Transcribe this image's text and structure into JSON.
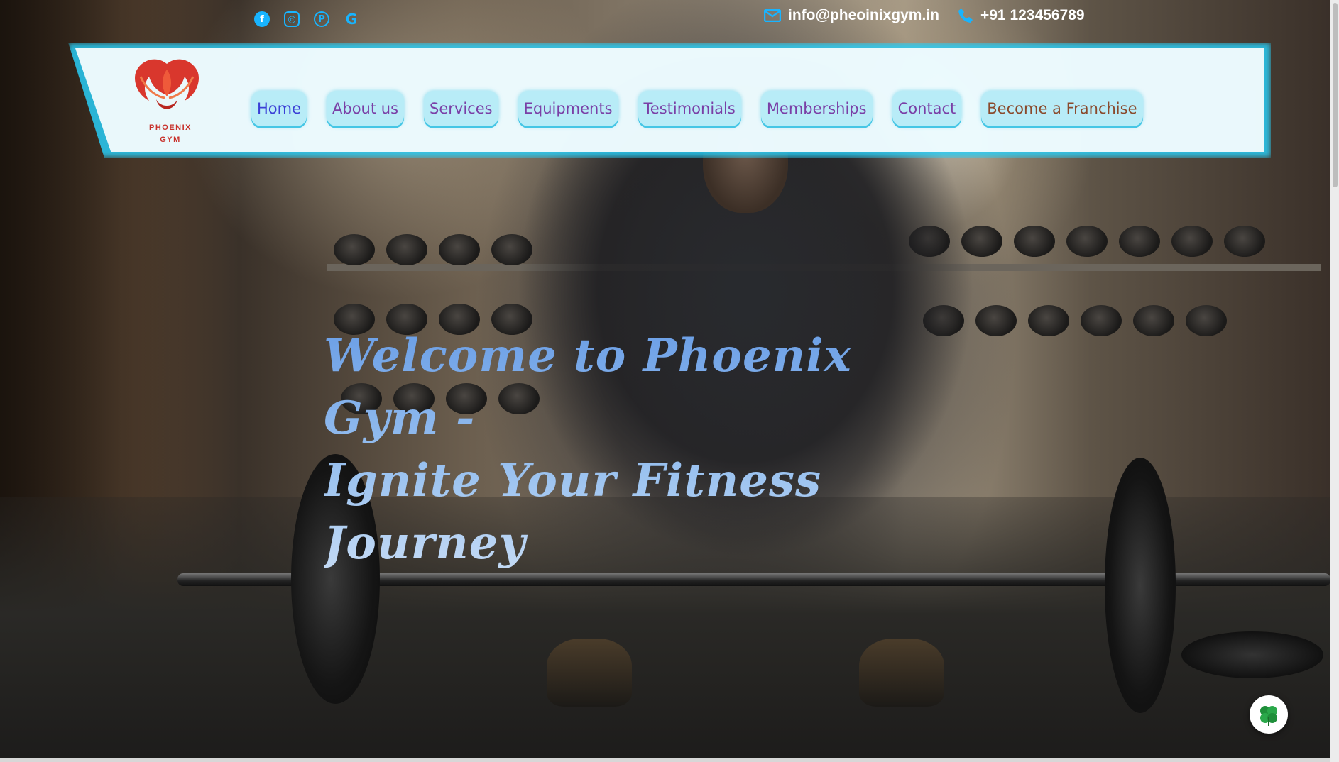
{
  "topbar": {
    "social_icons": [
      {
        "name": "facebook-icon",
        "glyph": "f"
      },
      {
        "name": "instagram-icon",
        "glyph": "◎"
      },
      {
        "name": "pinterest-icon",
        "glyph": "P"
      },
      {
        "name": "google-icon",
        "glyph": "G"
      }
    ],
    "email": "info@pheoinixgym.in",
    "phone": "+91 123456789",
    "accent_color": "#18b4ff"
  },
  "brand": {
    "logo_line1": "PHOENIX",
    "logo_line2": "GYM",
    "logo_color": "#c8302a"
  },
  "nav": {
    "items": [
      {
        "label": "Home",
        "active": true
      },
      {
        "label": "About us"
      },
      {
        "label": "Services"
      },
      {
        "label": "Equipments"
      },
      {
        "label": "Testimonials"
      },
      {
        "label": "Memberships"
      },
      {
        "label": "Contact"
      },
      {
        "label": "Become a Franchise"
      }
    ],
    "button_bg": "#b8ecf7",
    "glow_color": "#29cdf6"
  },
  "hero": {
    "headline_line1": "Welcome to Phoenix Gym -",
    "headline_line2": "Ignite Your Fitness Journey"
  },
  "widgets": {
    "chat_icon": "clover-icon"
  }
}
